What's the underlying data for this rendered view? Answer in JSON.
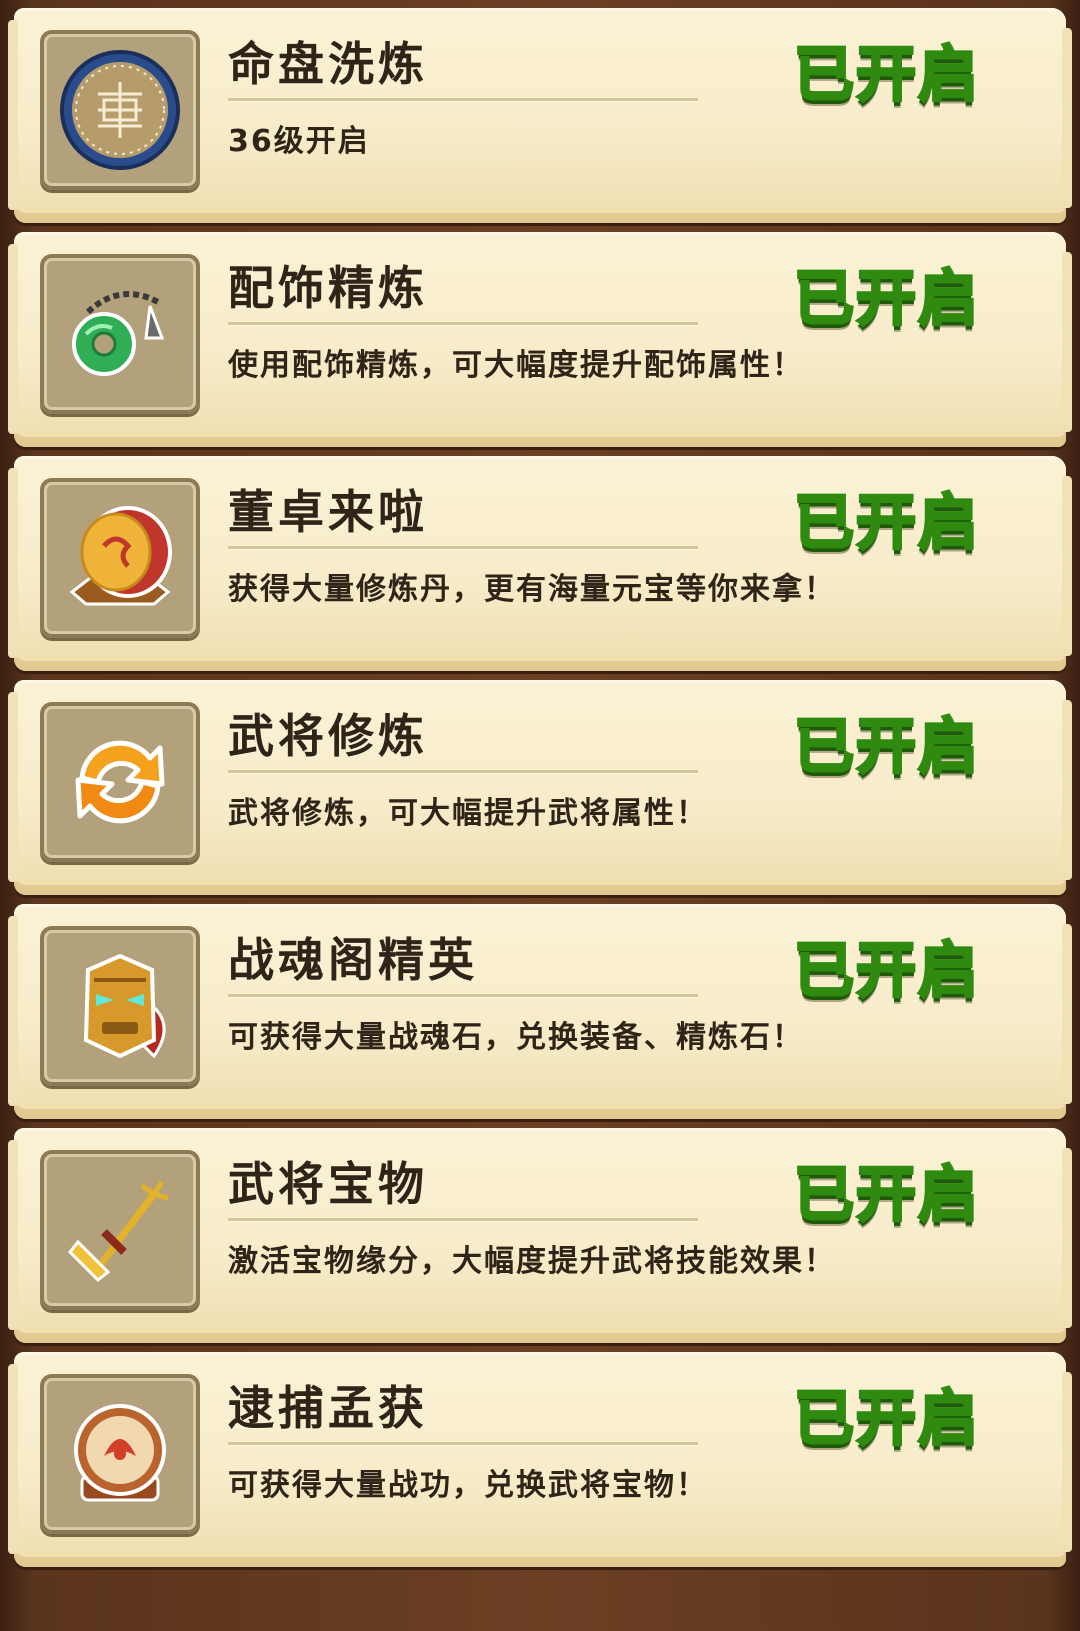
{
  "features": [
    {
      "title": "命盘洗炼",
      "desc": "36级开启",
      "status": "已开启",
      "icon": "star-disk-icon"
    },
    {
      "title": "配饰精炼",
      "desc": "使用配饰精炼，可大幅度提升配饰属性！",
      "status": "已开启",
      "icon": "jade-pendant-icon"
    },
    {
      "title": "董卓来啦",
      "desc": "获得大量修炼丹，更有海量元宝等你来拿！",
      "status": "已开启",
      "icon": "war-drum-icon"
    },
    {
      "title": "武将修炼",
      "desc": "武将修炼，可大幅提升武将属性！",
      "status": "已开启",
      "icon": "refresh-arrows-icon"
    },
    {
      "title": "战魂阁精英",
      "desc": "可获得大量战魂石，兑换装备、精炼石！",
      "status": "已开启",
      "icon": "golden-mask-icon"
    },
    {
      "title": "武将宝物",
      "desc": "激活宝物缘分，大幅度提升武将技能效果！",
      "status": "已开启",
      "icon": "trident-bell-icon"
    },
    {
      "title": "逮捕孟获",
      "desc": "可获得大量战功，兑换武将宝物！",
      "status": "已开启",
      "icon": "tribal-drum-icon"
    }
  ],
  "colors": {
    "status_green": "#4ed31c",
    "card_bg": "#f7ebc8",
    "frame": "#b3a17c",
    "text": "#2e2418"
  }
}
